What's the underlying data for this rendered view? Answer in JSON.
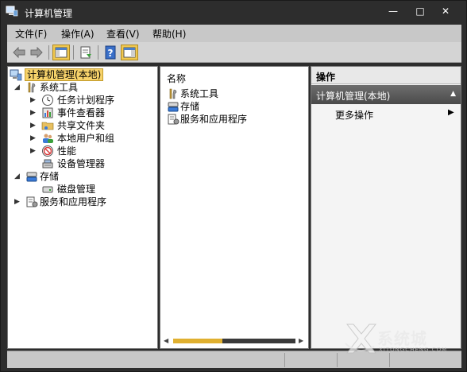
{
  "window": {
    "title": "计算机管理",
    "min_label": "—",
    "max_label": "□",
    "close_label": "✕"
  },
  "menubar": {
    "file": "文件(F)",
    "action": "操作(A)",
    "view": "查看(V)",
    "help": "帮助(H)"
  },
  "toolbar": {
    "icons": [
      "back-arrow-icon",
      "forward-arrow-icon",
      "show-hide-tree-icon",
      "export-list-icon",
      "help-icon",
      "show-hide-action-pane-icon"
    ]
  },
  "tree": {
    "root": "计算机管理(本地)",
    "system_tools": "系统工具",
    "task_scheduler": "任务计划程序",
    "event_viewer": "事件查看器",
    "shared_folders": "共享文件夹",
    "local_users": "本地用户和组",
    "performance": "性能",
    "device_manager": "设备管理器",
    "storage": "存储",
    "disk_management": "磁盘管理",
    "services_apps": "服务和应用程序"
  },
  "list": {
    "column_name": "名称",
    "items": [
      "系统工具",
      "存储",
      "服务和应用程序"
    ]
  },
  "actions": {
    "header": "操作",
    "group": "计算机管理(本地)",
    "more": "更多操作"
  },
  "watermark": {
    "text": "系统城",
    "sub": "XITONGCHENG.COM"
  },
  "colors": {
    "selection": "#f6d26a",
    "scroll_thumb": "#e0b030",
    "dark_chrome": "#2d2d2d"
  }
}
